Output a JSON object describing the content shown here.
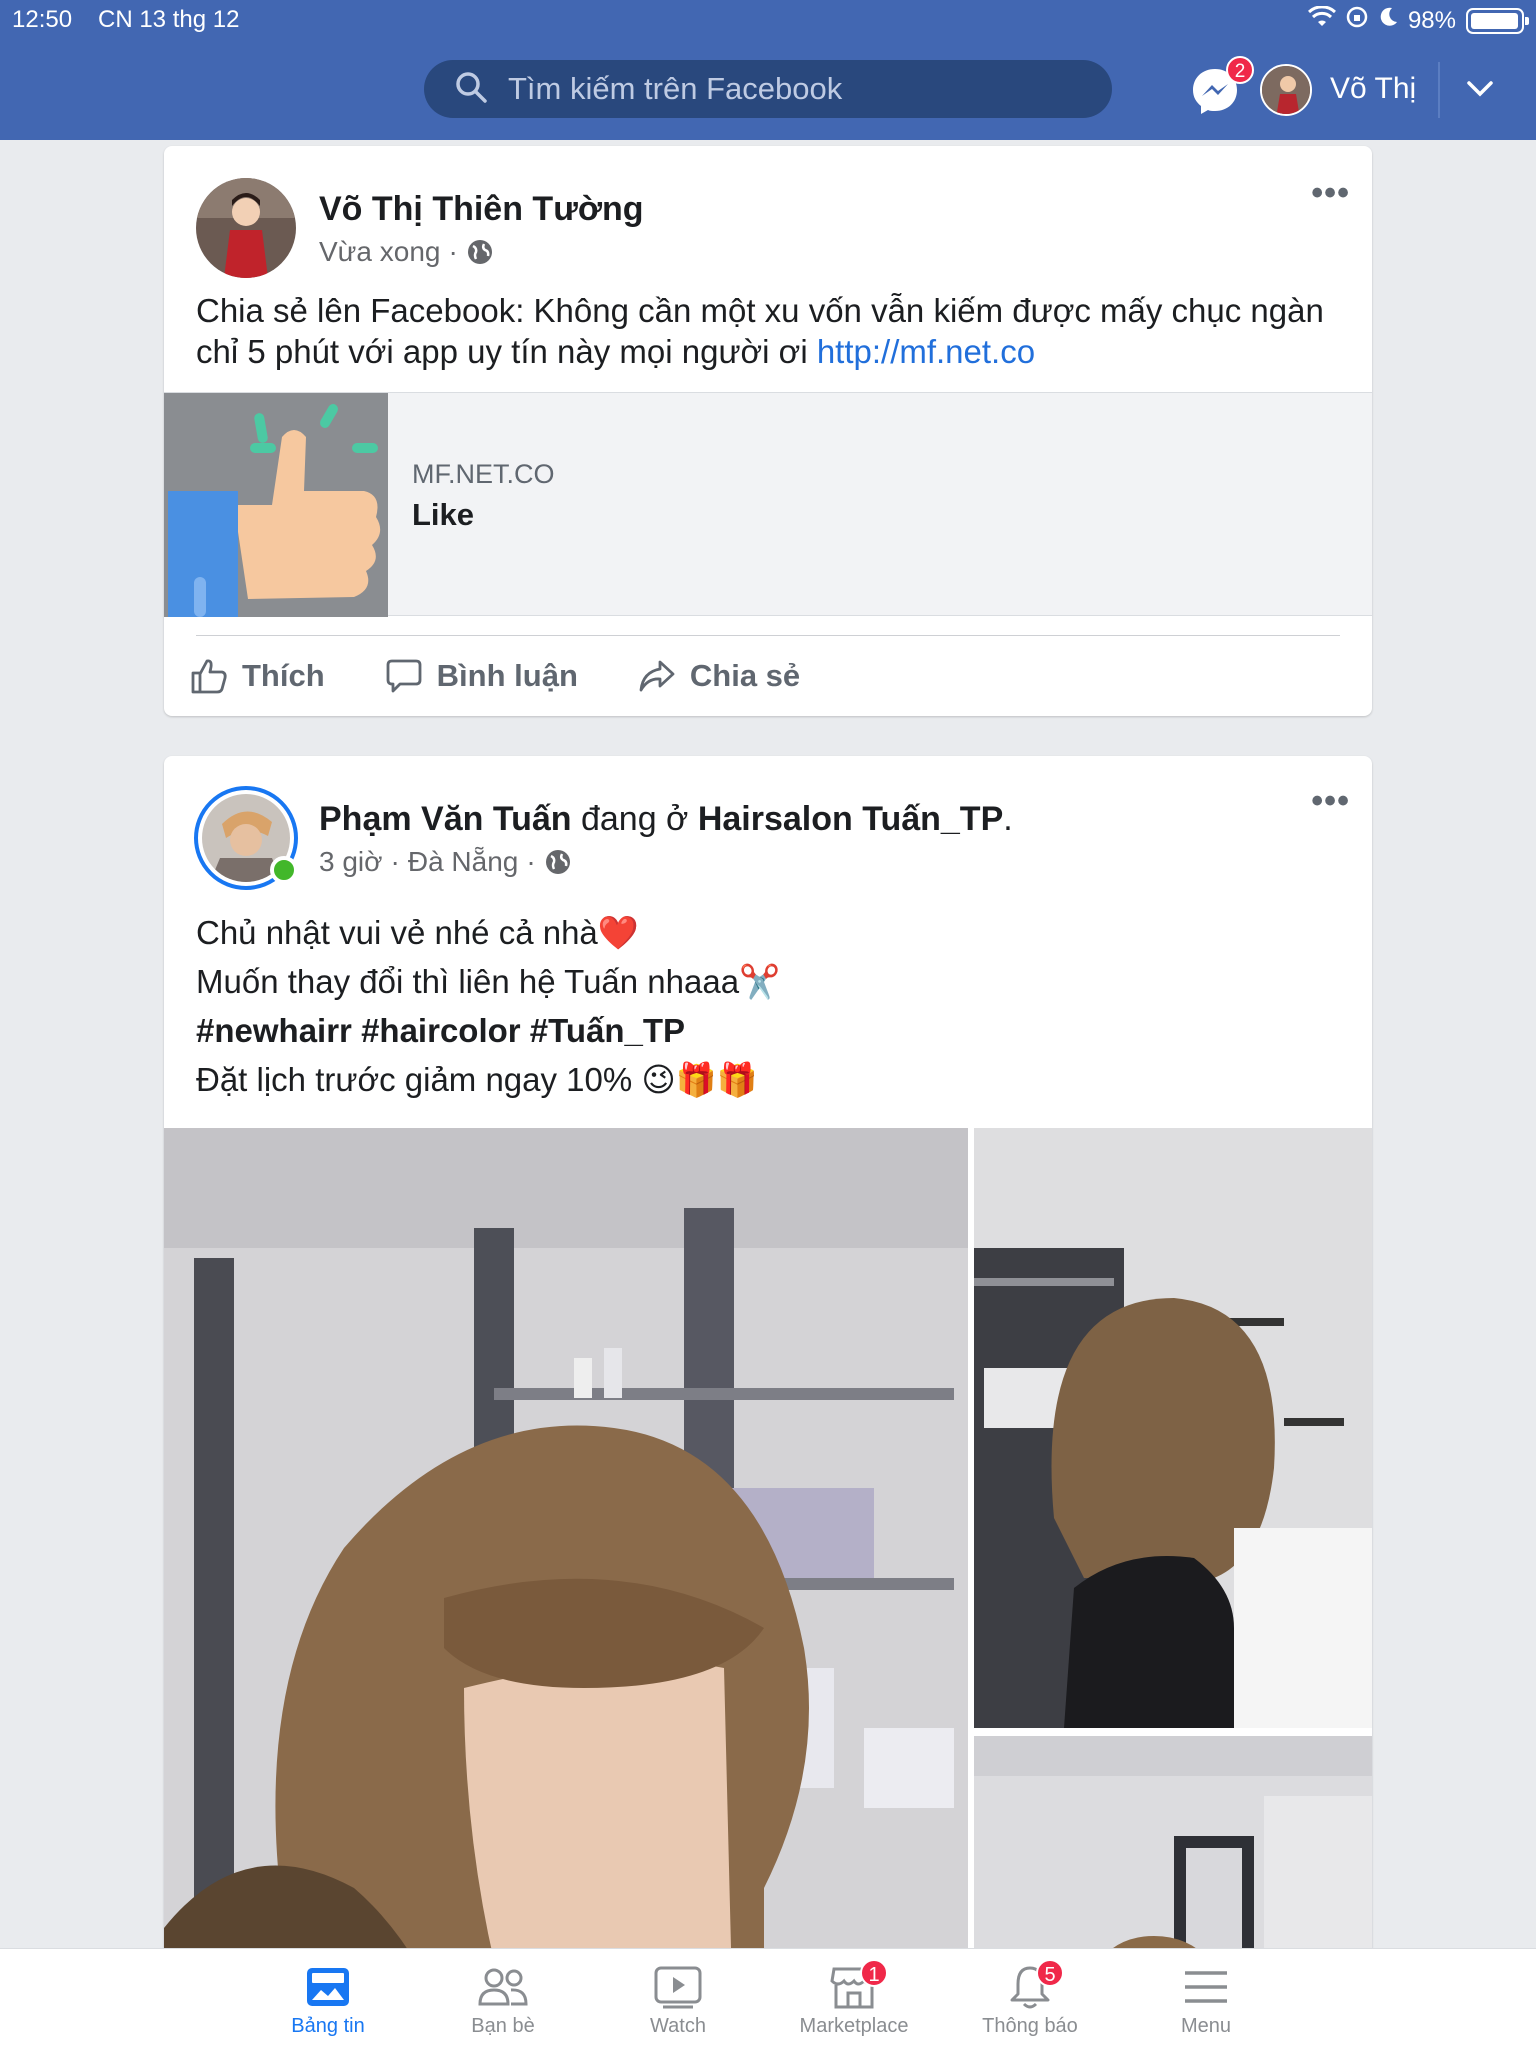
{
  "status_bar": {
    "time": "12:50",
    "date": "CN 13 thg 12",
    "battery": "98%",
    "battery_level": 0.98
  },
  "header": {
    "search_placeholder": "Tìm kiếm trên Facebook",
    "messenger_badge": "2",
    "user_name": "Võ Thị"
  },
  "post1": {
    "author": "Võ Thị Thiên Tường",
    "time": "Vừa xong",
    "text": "Chia sẻ lên Facebook: Không cần một xu vốn vẫn kiếm được mấy chục ngàn chỉ 5 phút với app uy tín này mọi người ơi ",
    "link": "http://mf.net.co",
    "preview": {
      "domain": "MF.NET.CO",
      "title": "Like"
    },
    "actions": {
      "like": "Thích",
      "comment": "Bình luận",
      "share": "Chia sẻ"
    }
  },
  "post2": {
    "author": "Phạm Văn Tuấn",
    "at_text": " đang ở ",
    "place": "Hairsalon Tuấn_TP",
    "period": ".",
    "time": "3 giờ",
    "location": "Đà Nẵng",
    "lines": [
      "Chủ nhật vui vẻ nhé cả nhà❤️",
      "Muốn thay đổi thì liên hệ Tuấn nhaaa✂️",
      "#newhairr #haircolor #Tuấn_TP",
      "Đặt lịch trước giảm ngay 10% 😉🎁🎁"
    ]
  },
  "bottom_nav": {
    "items": [
      {
        "label": "Bảng tin",
        "icon": "news-feed-icon"
      },
      {
        "label": "Bạn bè",
        "icon": "friends-icon"
      },
      {
        "label": "Watch",
        "icon": "watch-icon"
      },
      {
        "label": "Marketplace",
        "icon": "marketplace-icon",
        "badge": "1"
      },
      {
        "label": "Thông báo",
        "icon": "bell-icon",
        "badge": "5"
      },
      {
        "label": "Menu",
        "icon": "menu-icon"
      }
    ]
  },
  "colors": {
    "header_bg": "#4267b2",
    "link": "#216fdb",
    "active": "#1877f2",
    "badge": "#f02849"
  }
}
